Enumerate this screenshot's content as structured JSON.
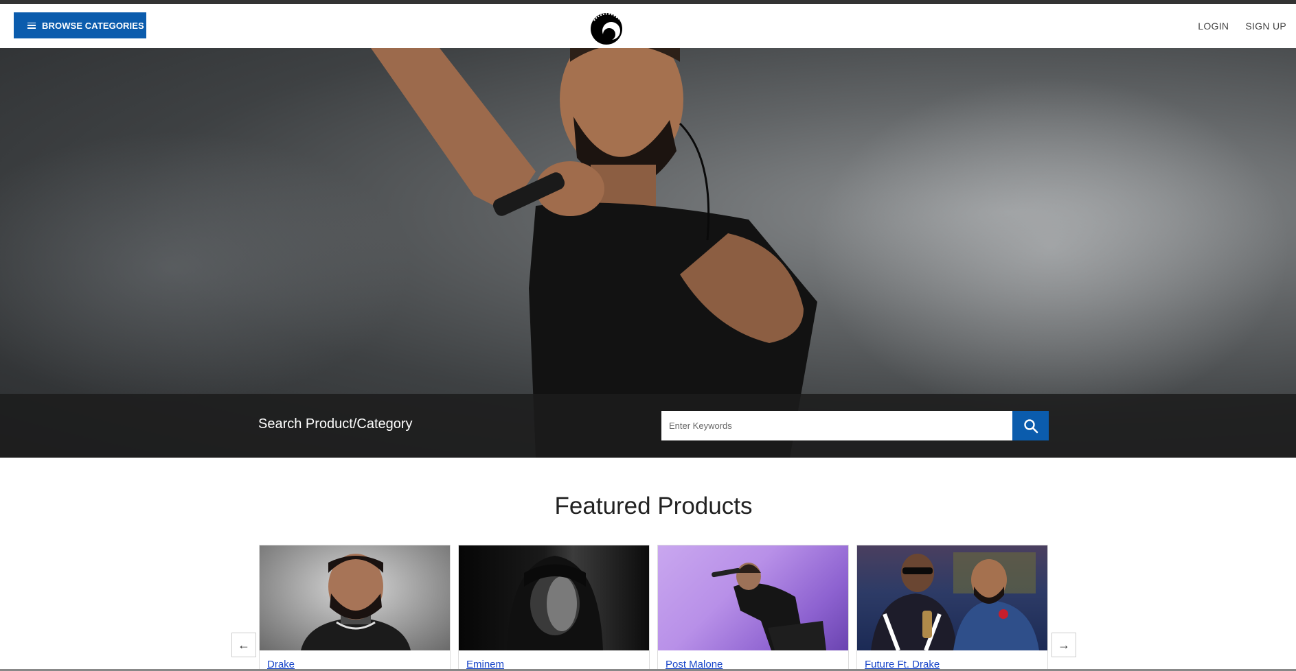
{
  "header": {
    "browse_label": "BROWSE CATEGORIES",
    "login_label": "LOGIN",
    "signup_label": "SIGN UP"
  },
  "search": {
    "label": "Search Product/Category",
    "placeholder": "Enter Keywords"
  },
  "featured": {
    "title": "Featured Products",
    "prev_icon": "←",
    "next_icon": "→",
    "items": [
      {
        "name": "Drake"
      },
      {
        "name": "Eminem"
      },
      {
        "name": "Post Malone"
      },
      {
        "name": "Future Ft. Drake"
      }
    ]
  },
  "colors": {
    "accent": "#0b5cad",
    "link": "#1a47c9",
    "search_band": "#1c1c1c"
  },
  "icons": {
    "menu": "hamburger-icon",
    "logo": "crescent-logo-icon",
    "search": "search-icon",
    "prev": "arrow-left-icon",
    "next": "arrow-right-icon"
  }
}
